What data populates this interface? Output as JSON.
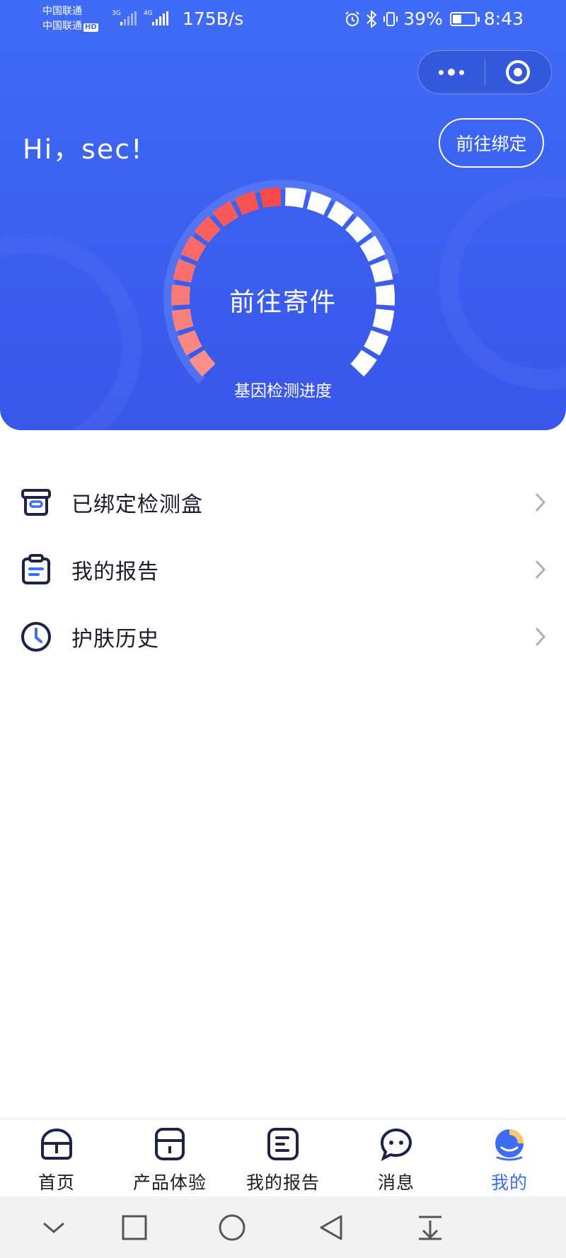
{
  "status_bar": {
    "carrier_1": "中国联通",
    "carrier_2": "中国联通",
    "hd_badge": "HD",
    "signal_1_type": "3G",
    "signal_2_type": "4G",
    "net_speed": "175B/s",
    "battery_percent": "39%",
    "battery_level": 0.39,
    "time": "8:43"
  },
  "header": {
    "greeting": "Hi，sec!",
    "bind_button": "前往绑定",
    "gauge": {
      "center_label": "前往寄件",
      "sub_label": "基因检测进度",
      "total_segments": 20,
      "filled_segments": 10,
      "colors": {
        "low": "#fb8f8a",
        "high": "#f84a4a",
        "empty": "#ffffff"
      }
    }
  },
  "menu": [
    {
      "label": "已绑定检测盒",
      "icon": "box-icon"
    },
    {
      "label": "我的报告",
      "icon": "clipboard-icon"
    },
    {
      "label": "护肤历史",
      "icon": "clock-icon"
    }
  ],
  "tabbar": {
    "items": [
      {
        "label": "首页",
        "icon": "home-icon"
      },
      {
        "label": "产品体验",
        "icon": "product-icon"
      },
      {
        "label": "我的报告",
        "icon": "report-icon"
      },
      {
        "label": "消息",
        "icon": "message-icon"
      },
      {
        "label": "我的",
        "icon": "profile-icon"
      }
    ],
    "active_index": 4,
    "active_color": "#3f6cf6"
  },
  "colors": {
    "primary": "#3f6cf6",
    "icon_dark": "#1d2346",
    "text_dark": "#1a1a2a"
  }
}
